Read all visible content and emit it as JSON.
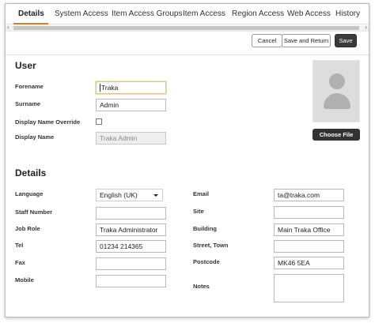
{
  "tabs": [
    {
      "label": "Details",
      "active": true
    },
    {
      "label": "System Access"
    },
    {
      "label": "Item Access Groups"
    },
    {
      "label": "Item Access"
    },
    {
      "label": "Region Access"
    },
    {
      "label": "Web Access"
    },
    {
      "label": "History"
    }
  ],
  "scroll": {
    "left_arrow": "‹",
    "right_arrow": "›"
  },
  "toolbar": {
    "cancel": "Cancel",
    "save_and_return": "Save and Return",
    "save": "Save"
  },
  "user": {
    "title": "User",
    "forename_label": "Forename",
    "forename_value": "Traka",
    "surname_label": "Surname",
    "surname_value": "Admin",
    "display_override_label": "Display Name Override",
    "display_name_label": "Display Name",
    "display_name_value": "Traka Admin",
    "choose_file": "Choose File"
  },
  "details": {
    "title": "Details",
    "language_label": "Language",
    "language_value": "English (UK)",
    "staff_number_label": "Staff Number",
    "staff_number_value": "",
    "job_role_label": "Job Role",
    "job_role_value": "Traka Administrator",
    "tel_label": "Tel",
    "tel_value": "01234 214365",
    "fax_label": "Fax",
    "fax_value": "",
    "mobile_label": "Mobile",
    "mobile_value": "",
    "email_label": "Email",
    "email_value": "ta@traka.com",
    "site_label": "Site",
    "site_value": "",
    "building_label": "Building",
    "building_value": "Main Traka Office",
    "street_label": "Street, Town",
    "street_value": "",
    "postcode_label": "Postcode",
    "postcode_value": "MK46 5EA",
    "notes_label": "Notes"
  },
  "colors": {
    "accent": "#e07b1a",
    "dark_button": "#3a3a3a"
  }
}
